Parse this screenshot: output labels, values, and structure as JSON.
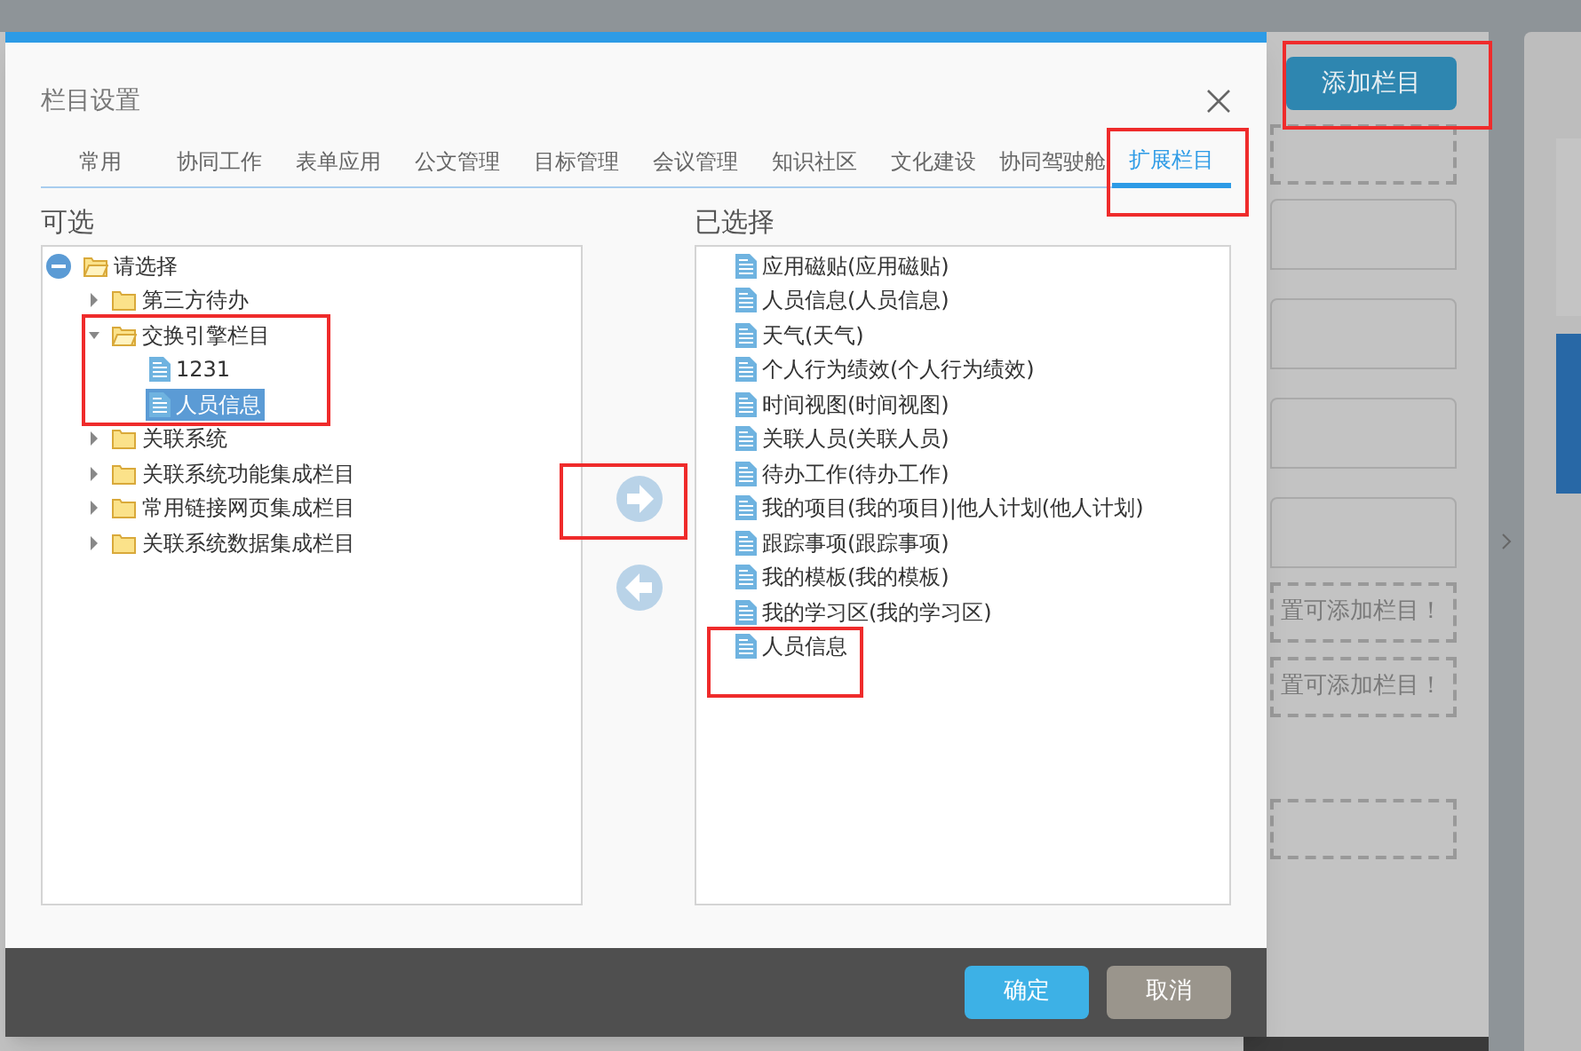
{
  "background": {
    "add_button": "添加栏目",
    "hints": [
      "置可添加栏目！",
      "置可添加栏目！"
    ]
  },
  "dialog": {
    "title": "栏目设置",
    "tabs": [
      {
        "label": "常用",
        "selected": false
      },
      {
        "label": "协同工作",
        "selected": false
      },
      {
        "label": "表单应用",
        "selected": false
      },
      {
        "label": "公文管理",
        "selected": false
      },
      {
        "label": "目标管理",
        "selected": false
      },
      {
        "label": "会议管理",
        "selected": false
      },
      {
        "label": "知识社区",
        "selected": false
      },
      {
        "label": "文化建设",
        "selected": false
      },
      {
        "label": "协同驾驶舱",
        "selected": false
      },
      {
        "label": "扩展栏目",
        "selected": true
      }
    ],
    "available_label": "可选",
    "tree": [
      {
        "label": "请选择",
        "kind": "root",
        "expanded": true,
        "children": [
          {
            "label": "第三方待办",
            "kind": "folder",
            "expanded": false
          },
          {
            "label": "交换引擎栏目",
            "kind": "folder",
            "expanded": true,
            "children": [
              {
                "label": "1231",
                "kind": "file",
                "selected": false
              },
              {
                "label": "人员信息",
                "kind": "file",
                "selected": true
              }
            ]
          },
          {
            "label": "关联系统",
            "kind": "folder",
            "expanded": false
          },
          {
            "label": "关联系统功能集成栏目",
            "kind": "folder",
            "expanded": false
          },
          {
            "label": "常用链接网页集成栏目",
            "kind": "folder",
            "expanded": false
          },
          {
            "label": "关联系统数据集成栏目",
            "kind": "folder",
            "expanded": false
          }
        ]
      }
    ],
    "selected_label": "已选择",
    "selected_items": [
      "应用磁贴(应用磁贴)",
      "人员信息(人员信息)",
      "天气(天气)",
      "个人行为绩效(个人行为绩效)",
      "时间视图(时间视图)",
      "关联人员(关联人员)",
      "待办工作(待办工作)",
      "我的项目(我的项目)|他人计划(他人计划)",
      "跟踪事项(跟踪事项)",
      "我的模板(我的模板)",
      "我的学习区(我的学习区)",
      "人员信息"
    ],
    "buttons": {
      "ok": "确定",
      "cancel": "取消"
    }
  }
}
